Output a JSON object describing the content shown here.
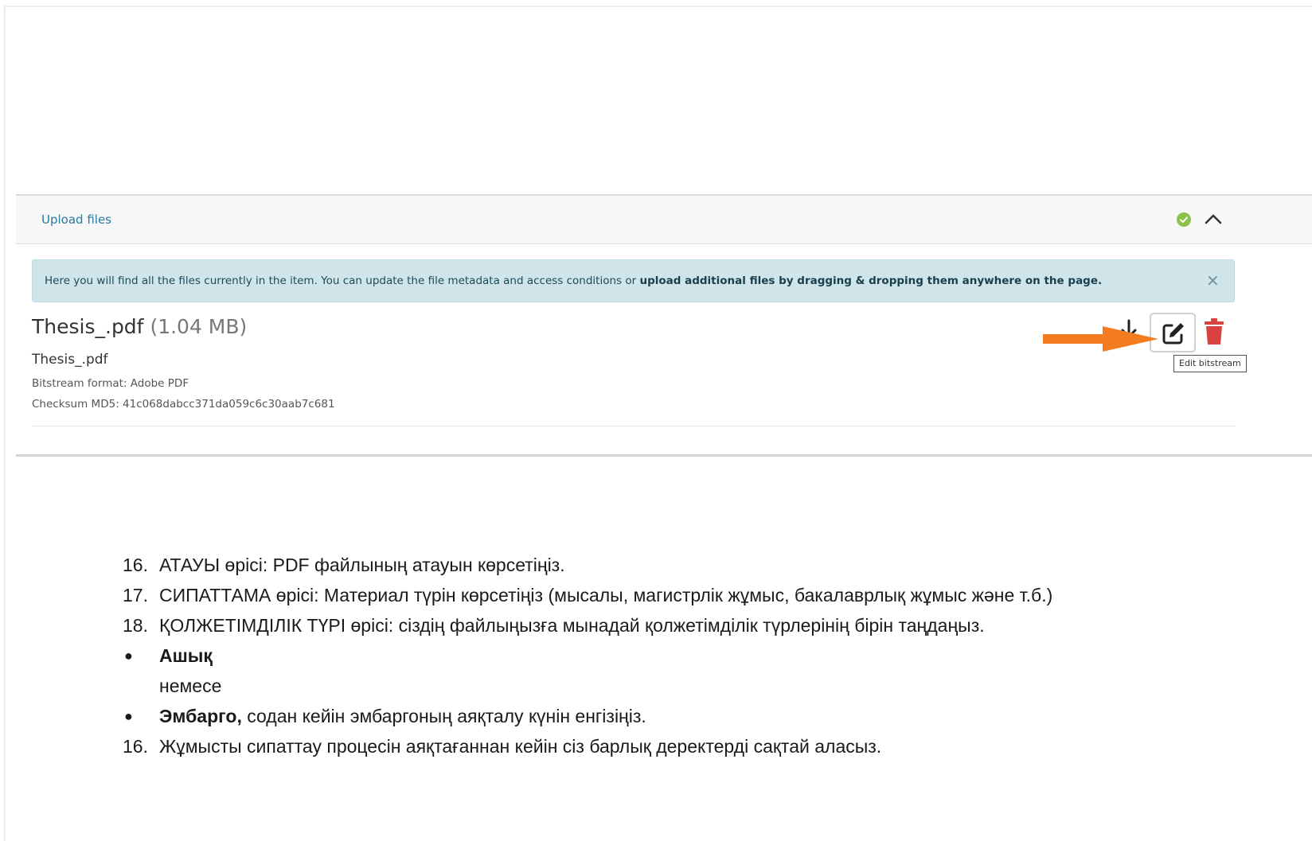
{
  "panel": {
    "title": "Upload files",
    "alert": {
      "text_normal": "Here you will find all the files currently in the item. You can update the file metadata and access conditions or ",
      "text_bold": "upload additional files by dragging & dropping them anywhere on the page.",
      "close": "×"
    },
    "file": {
      "title": "Thesis_.pdf",
      "size": "(1.04 MB)",
      "name": "Thesis_.pdf",
      "format": "Bitstream format: Adobe PDF",
      "checksum": "Checksum MD5: 41c068dabcc371da059c6c30aab7c681"
    },
    "tooltip": "Edit bitstream",
    "colors": {
      "accent": "#2b7a9a",
      "success": "#8bc34a",
      "danger": "#d9433f",
      "annotation_arrow": "#f47c20"
    },
    "icons": [
      "check-circle-icon",
      "chevron-up-icon",
      "close-icon",
      "download-icon",
      "edit-icon",
      "trash-icon"
    ]
  },
  "instructions": {
    "items": [
      {
        "marker": "16.",
        "text": "АТАУЫ өрісі: PDF файлының атауын көрсетіңіз."
      },
      {
        "marker": "17.",
        "text": "СИПАТТАМА өрісі: Материал түрін көрсетіңіз (мысалы, магистрлік жұмыс, бакалаврлық жұмыс және т.б.)"
      },
      {
        "marker": "18.",
        "text": "ҚОЛЖЕТІМДІЛІК ТҮРІ өрісі: сіздің файлыңызға мынадай қолжетімділік түрлерінің бірін таңдаңыз."
      },
      {
        "marker": "●",
        "bold": "Ашық",
        "text": ""
      },
      {
        "marker": "",
        "text": "немесе"
      },
      {
        "marker": "●",
        "bold": "Эмбарго,",
        "text": " содан кейін эмбаргоның аяқталу күнін енгізіңіз."
      },
      {
        "marker": "16.",
        "text": "Жұмысты сипаттау процесін аяқтағаннан кейін сіз барлық деректерді сақтай аласыз."
      }
    ]
  }
}
